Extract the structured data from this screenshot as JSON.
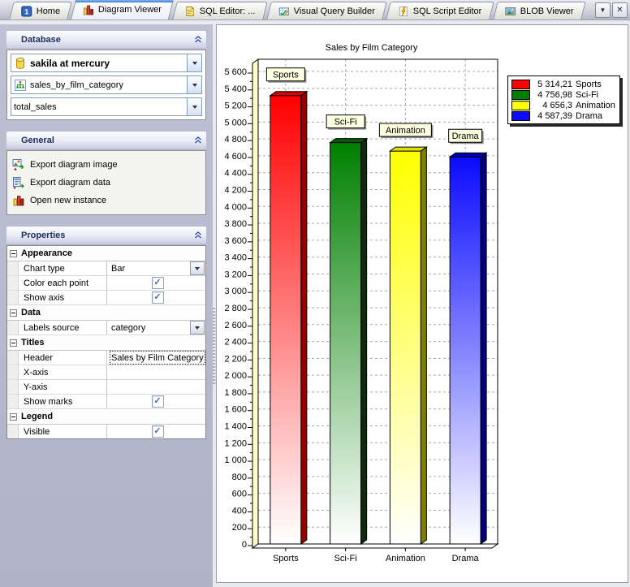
{
  "window": {
    "tabs": [
      {
        "label": "Home",
        "icon": "one-badge-icon",
        "active": false
      },
      {
        "label": "Diagram Viewer",
        "icon": "diagram-icon",
        "active": true
      },
      {
        "label": "SQL Editor: ...",
        "icon": "sql-document-icon",
        "active": false
      },
      {
        "label": "Visual Query Builder",
        "icon": "query-builder-icon",
        "active": false
      },
      {
        "label": "SQL Script Editor",
        "icon": "script-icon",
        "active": false
      },
      {
        "label": "BLOB Viewer",
        "icon": "blob-image-icon",
        "active": false
      }
    ],
    "controls": {
      "dropdown_glyph": "▼",
      "close_glyph": "✕"
    }
  },
  "sidebar": {
    "database_panel": {
      "title": "Database",
      "dropdowns": [
        {
          "value": "sakila at mercury",
          "icon": "database-icon",
          "bold": true
        },
        {
          "value": "sales_by_film_category",
          "icon": "view-icon",
          "bold": false
        },
        {
          "value": "total_sales",
          "icon": "none",
          "bold": false
        }
      ]
    },
    "general_panel": {
      "title": "General",
      "items": [
        {
          "label": "Export diagram image",
          "icon": "export-image-icon"
        },
        {
          "label": "Export diagram data",
          "icon": "export-data-icon"
        },
        {
          "label": "Open new instance",
          "icon": "new-instance-icon"
        }
      ]
    },
    "properties_panel": {
      "title": "Properties",
      "groups": [
        {
          "label": "Appearance",
          "rows": [
            {
              "label": "Chart type",
              "type": "dropdown",
              "value": "Bar"
            },
            {
              "label": "Color each point",
              "type": "checkbox",
              "checked": true
            },
            {
              "label": "Show axis",
              "type": "checkbox",
              "checked": true
            }
          ]
        },
        {
          "label": "Data",
          "rows": [
            {
              "label": "Labels source",
              "type": "dropdown",
              "value": "category"
            }
          ]
        },
        {
          "label": "Titles",
          "rows": [
            {
              "label": "Header",
              "type": "text",
              "value": "Sales by Film Category",
              "focused": true
            },
            {
              "label": "X-axis",
              "type": "text",
              "value": ""
            },
            {
              "label": "Y-axis",
              "type": "text",
              "value": ""
            },
            {
              "label": "Show marks",
              "type": "checkbox",
              "checked": true
            }
          ]
        },
        {
          "label": "Legend",
          "rows": [
            {
              "label": "Visible",
              "type": "checkbox",
              "checked": true
            }
          ]
        }
      ]
    }
  },
  "chart_data": {
    "type": "bar",
    "title": "Sales by Film Category",
    "title_color": "#0000E8",
    "categories": [
      "Sports",
      "Sci-Fi",
      "Animation",
      "Drama"
    ],
    "values": [
      5314.21,
      4756.98,
      4656.3,
      4587.39
    ],
    "value_labels": [
      "5 314,21",
      "4 756,98",
      "4 656,3",
      "4 587,39"
    ],
    "series_colors": [
      {
        "main": "#FF0000",
        "top": "#D80000",
        "side": "#970000"
      },
      {
        "main": "#008000",
        "top": "#005A00",
        "side": "#0B2B0B"
      },
      {
        "main": "#FFFF00",
        "top": "#DFDF00",
        "side": "#7F7F00"
      },
      {
        "main": "#0B0BFF",
        "top": "#0000AF",
        "side": "#00007F"
      }
    ],
    "ylim": [
      0,
      5600
    ],
    "y_step": 200,
    "grid": true,
    "wall_color": "#FFFFC8",
    "mark_fill": "#FFFFE1",
    "legend_position": "top-right",
    "marks": true,
    "xlabel": "",
    "ylabel": ""
  }
}
